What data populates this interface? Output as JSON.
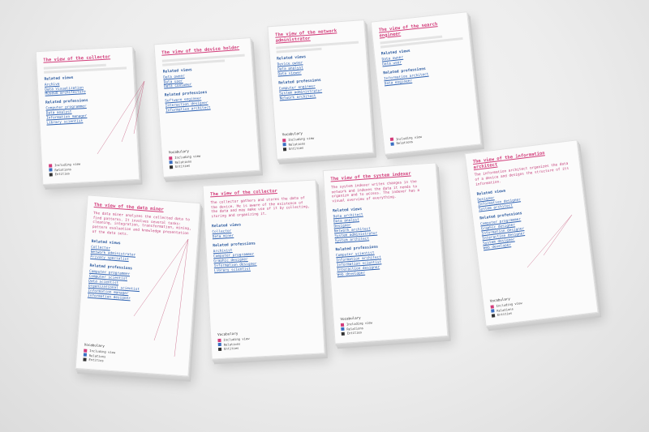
{
  "legend": {
    "title": "Vocabulary",
    "items": [
      "Including view",
      "Relations",
      "Entities"
    ],
    "colors": {
      "view": "#d23c7a",
      "relations": "#3b6fc2",
      "entities": "#333333"
    }
  },
  "labels": {
    "related_views": "Related views",
    "related_professions": "Related professions"
  },
  "cards": [
    {
      "title": "The view of the collector",
      "body": "",
      "views": [
        "Archive",
        "Data Visualization",
        "Museum architecture"
      ],
      "professions": [
        "Computer programmer",
        "Data analyst",
        "Information manager",
        "Library scientist"
      ]
    },
    {
      "title": "The view of the device holder",
      "body": "",
      "views": [
        "Data owner",
        "Data user",
        "Data consumer"
      ],
      "professions": [
        "Software engineer",
        "Interaction designer",
        "Information architect"
      ]
    },
    {
      "title": "The view of the network administrator",
      "body": "",
      "views": [
        "Device owner",
        "Data analyst",
        "Data viewer"
      ],
      "professions": [
        "Computer engineer",
        "System administrator",
        "Network architect"
      ]
    },
    {
      "title": "The view of the search engineer",
      "body": "",
      "views": [
        "Data owner",
        "Data user"
      ],
      "professions": [
        "Information architect",
        "Data engineer"
      ]
    },
    {
      "title": "The view of the data miner",
      "body": "The data miner analyzes the collected data to find patterns. It involves several tasks: cleaning, integration, transformation, mining, pattern evaluation and knowledge presentation of the data sets.",
      "views": [
        "Collector",
        "Network administrator",
        "Privacy specialist"
      ],
      "professions": [
        "Computer programmer",
        "Computer scientist",
        "Data scientist",
        "Organizational scientist",
        "Information manager",
        "Information designer"
      ]
    },
    {
      "title": "The view of the collector",
      "body": "The collector gathers and stores the data of the device. He is aware of the existence of the data and may make use of it by collecting, storing and organizing it.",
      "views": [
        "Collector",
        "Data miner"
      ],
      "professions": [
        "Archivist",
        "Computer programmer",
        "Graphic designer",
        "Information designer",
        "Library scientist"
      ]
    },
    {
      "title": "The view of the system indexer",
      "body": "The system indexer writes changes in the network and indexes the data it needs to organize and to access. The indexer has a visual overview of everything.",
      "views": [
        "Data architect",
        "Data analyst",
        "Designer",
        "Network architect",
        "System administrator",
        "System architect"
      ],
      "professions": [
        "Computer scientist",
        "Information architect",
        "Information scientist",
        "Interaction designer",
        "Web developer"
      ]
    },
    {
      "title": "The view of the information architect",
      "body": "The information architect organizes the data of a device and designs the structure of its information.",
      "views": [
        "Designer",
        "Information designer",
        "System architect"
      ],
      "professions": [
        "Computer programmer",
        "Graphic designer",
        "Information designer",
        "Interaction designer",
        "System designer",
        "Web developer"
      ]
    }
  ]
}
